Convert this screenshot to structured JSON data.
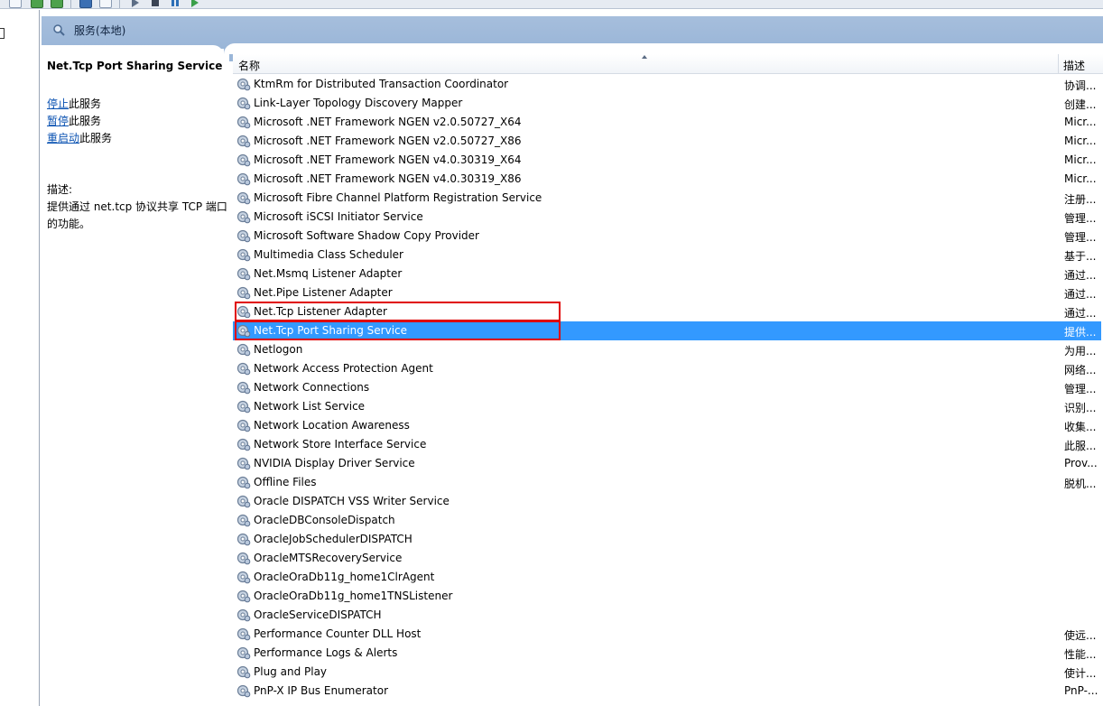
{
  "header": {
    "title": "服务(本地)"
  },
  "side": {
    "service_title": "Net.Tcp Port Sharing Service",
    "actions": [
      {
        "link": "停止",
        "suffix": "此服务"
      },
      {
        "link": "暂停",
        "suffix": "此服务"
      },
      {
        "link": "重启动",
        "suffix": "此服务"
      }
    ],
    "desc_label": "描述:",
    "desc_text": "提供通过 net.tcp 协议共享 TCP 端口的功能。"
  },
  "columns": {
    "name": "名称",
    "desc": "描述"
  },
  "services": [
    {
      "name": "KtmRm for Distributed Transaction Coordinator",
      "desc": "协调..."
    },
    {
      "name": "Link-Layer Topology Discovery Mapper",
      "desc": "创建..."
    },
    {
      "name": "Microsoft .NET Framework NGEN v2.0.50727_X64",
      "desc": "Micr..."
    },
    {
      "name": "Microsoft .NET Framework NGEN v2.0.50727_X86",
      "desc": "Micr..."
    },
    {
      "name": "Microsoft .NET Framework NGEN v4.0.30319_X64",
      "desc": "Micr..."
    },
    {
      "name": "Microsoft .NET Framework NGEN v4.0.30319_X86",
      "desc": "Micr..."
    },
    {
      "name": "Microsoft Fibre Channel Platform Registration Service",
      "desc": "注册..."
    },
    {
      "name": "Microsoft iSCSI Initiator Service",
      "desc": "管理..."
    },
    {
      "name": "Microsoft Software Shadow Copy Provider",
      "desc": "管理..."
    },
    {
      "name": "Multimedia Class Scheduler",
      "desc": "基于..."
    },
    {
      "name": "Net.Msmq Listener Adapter",
      "desc": "通过..."
    },
    {
      "name": "Net.Pipe Listener Adapter",
      "desc": "通过..."
    },
    {
      "name": "Net.Tcp Listener Adapter",
      "desc": "通过..."
    },
    {
      "name": "Net.Tcp Port Sharing Service",
      "desc": "提供..."
    },
    {
      "name": "Netlogon",
      "desc": "为用..."
    },
    {
      "name": "Network Access Protection Agent",
      "desc": "网络..."
    },
    {
      "name": "Network Connections",
      "desc": "管理..."
    },
    {
      "name": "Network List Service",
      "desc": "识别..."
    },
    {
      "name": "Network Location Awareness",
      "desc": "收集..."
    },
    {
      "name": "Network Store Interface Service",
      "desc": "此服..."
    },
    {
      "name": "NVIDIA Display Driver Service",
      "desc": "Prov..."
    },
    {
      "name": "Offline Files",
      "desc": "脱机..."
    },
    {
      "name": "Oracle DISPATCH VSS Writer Service",
      "desc": ""
    },
    {
      "name": "OracleDBConsoleDispatch",
      "desc": ""
    },
    {
      "name": "OracleJobSchedulerDISPATCH",
      "desc": ""
    },
    {
      "name": "OracleMTSRecoveryService",
      "desc": ""
    },
    {
      "name": "OracleOraDb11g_home1ClrAgent",
      "desc": ""
    },
    {
      "name": "OracleOraDb11g_home1TNSListener",
      "desc": ""
    },
    {
      "name": "OracleServiceDISPATCH",
      "desc": ""
    },
    {
      "name": "Performance Counter DLL Host",
      "desc": "使远..."
    },
    {
      "name": "Performance Logs & Alerts",
      "desc": "性能..."
    },
    {
      "name": "Plug and Play",
      "desc": "使计..."
    },
    {
      "name": "PnP-X IP Bus Enumerator",
      "desc": "PnP-..."
    }
  ],
  "selected_index": 13,
  "highlight_indices": [
    12,
    13
  ],
  "colors": {
    "selection": "#3399ff",
    "highlight_box": "#e00000",
    "header_band": "#9ab6d8",
    "link": "#0a52b2"
  }
}
